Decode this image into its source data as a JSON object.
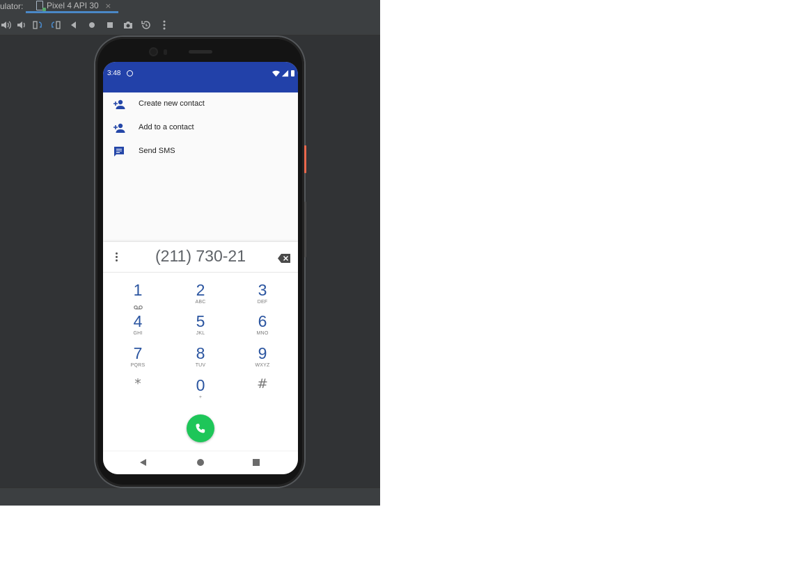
{
  "ide": {
    "tool_window_label": "ulator:",
    "device_tab": {
      "title": "Pixel 4 API 30",
      "close": "×"
    },
    "toolbar": [
      {
        "icon": "volume-up-icon"
      },
      {
        "icon": "volume-down-icon"
      },
      {
        "icon": "rotate-left-icon"
      },
      {
        "icon": "rotate-right-icon"
      },
      {
        "icon": "back-icon"
      },
      {
        "icon": "home-icon"
      },
      {
        "icon": "overview-icon"
      },
      {
        "icon": "camera-icon"
      },
      {
        "icon": "snapshot-icon"
      },
      {
        "icon": "more-icon"
      }
    ]
  },
  "phone": {
    "status_bar": {
      "time": "3:48",
      "color": "#2241a9"
    },
    "options": [
      {
        "label": "Create new contact",
        "icon": "person-add-icon"
      },
      {
        "label": "Add to a contact",
        "icon": "person-add-icon"
      },
      {
        "label": "Send SMS",
        "icon": "message-icon"
      }
    ],
    "dialpad": {
      "number": "(211) 730-21",
      "keys": [
        {
          "digit": "1",
          "letters": ""
        },
        {
          "digit": "2",
          "letters": "ABC"
        },
        {
          "digit": "3",
          "letters": "DEF"
        },
        {
          "digit": "4",
          "letters": "GHI"
        },
        {
          "digit": "5",
          "letters": "JKL"
        },
        {
          "digit": "6",
          "letters": "MNO"
        },
        {
          "digit": "7",
          "letters": "PQRS"
        },
        {
          "digit": "8",
          "letters": "TUV"
        },
        {
          "digit": "9",
          "letters": "WXYZ"
        },
        {
          "digit": "*",
          "letters": ""
        },
        {
          "digit": "0",
          "letters": "+"
        },
        {
          "digit": "#",
          "letters": ""
        }
      ],
      "call_color": "#1ec659"
    }
  }
}
